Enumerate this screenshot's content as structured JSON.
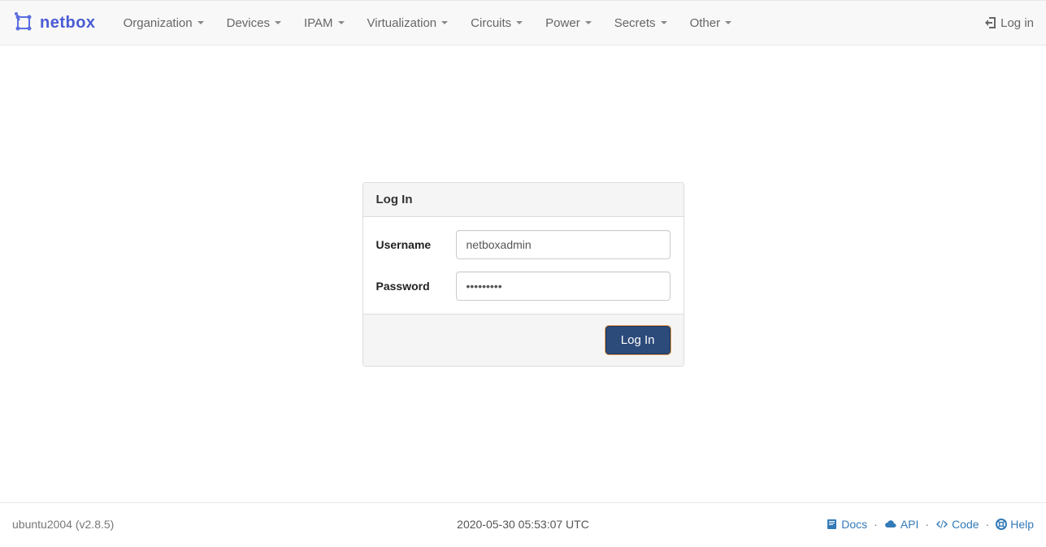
{
  "brand": {
    "text": "netbox"
  },
  "nav": {
    "items": [
      {
        "label": "Organization"
      },
      {
        "label": "Devices"
      },
      {
        "label": "IPAM"
      },
      {
        "label": "Virtualization"
      },
      {
        "label": "Circuits"
      },
      {
        "label": "Power"
      },
      {
        "label": "Secrets"
      },
      {
        "label": "Other"
      }
    ],
    "login": "Log in"
  },
  "login_panel": {
    "title": "Log In",
    "username_label": "Username",
    "username_value": "netboxadmin",
    "password_label": "Password",
    "password_value": "•••••••••",
    "submit": "Log In"
  },
  "footer": {
    "host": "ubuntu2004 (v2.8.5)",
    "timestamp": "2020-05-30 05:53:07 UTC",
    "links": {
      "docs": "Docs",
      "api": "API",
      "code": "Code",
      "help": "Help"
    }
  }
}
